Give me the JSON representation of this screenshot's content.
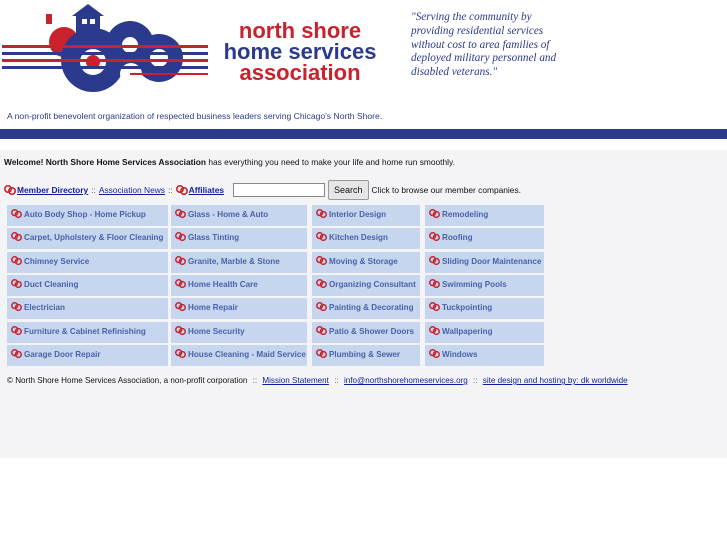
{
  "header": {
    "logo_line1": "north shore",
    "logo_line2": "home services",
    "logo_line3": "association",
    "quote": "\"Serving the community by providing residential services without cost to area families of deployed military personnel and disabled veterans.\"",
    "tagline": "A non-profit benevolent organization of respected business leaders serving Chicago's North Shore."
  },
  "welcome": {
    "bold": "Welcome! North Shore Home Services Association",
    "rest": " has everything you need to make your life and home run smoothly."
  },
  "nav": {
    "member_directory": "Member Directory",
    "sep": "::",
    "association_news": "Association News",
    "affiliates": "Affiliates",
    "search_value": "",
    "search_button": "Search",
    "browse_text": "Click to browse our member companies."
  },
  "categories": [
    [
      "Auto Body Shop - Home Pickup",
      "Glass - Home & Auto",
      "Interior Design",
      "Remodeling"
    ],
    [
      "Carpet, Upholstery & Floor Cleaning",
      "Glass Tinting",
      "Kitchen Design",
      "Roofing"
    ],
    [
      "Chimney Service",
      "Granite, Marble & Stone",
      "Moving & Storage",
      "Sliding Door Maintenance"
    ],
    [
      "Duct Cleaning",
      "Home Health Care",
      "Organizing Consultant",
      "Swimming Pools"
    ],
    [
      "Electrician",
      "Home Repair",
      "Painting & Decorating",
      "Tuckpointing"
    ],
    [
      "Furniture & Cabinet Refinishing",
      "Home Security",
      "Patio & Shower Doors",
      "Wallpapering"
    ],
    [
      "Garage Door Repair",
      "House Cleaning - Maid Service",
      "Plumbing & Sewer",
      "Windows"
    ]
  ],
  "footer": {
    "text": "© North Shore Home Services Association, a non-profit corporation",
    "sep": "::",
    "mission": "Mission Statement",
    "email": "info@northshorehomeservices.org",
    "design": "site design and hosting by: dk worldwide"
  },
  "colors": {
    "brand_red": "#c8232c",
    "brand_blue": "#2b3a8c",
    "cell_bg": "#c6d6ef",
    "cell_text": "#4a62a8",
    "link": "#0f1f9c"
  }
}
